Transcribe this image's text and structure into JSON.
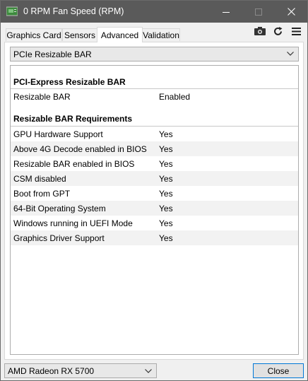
{
  "window": {
    "title": "0 RPM Fan Speed (RPM)"
  },
  "tabs": [
    {
      "label": "Graphics Card"
    },
    {
      "label": "Sensors"
    },
    {
      "label": "Advanced",
      "active": true
    },
    {
      "label": "Validation"
    }
  ],
  "toolbar": {
    "icons": [
      "camera-icon",
      "refresh-icon",
      "menu-icon"
    ]
  },
  "category_select": {
    "selected": "PCIe Resizable BAR"
  },
  "sections": {
    "pcie": {
      "heading": "PCI-Express Resizable BAR",
      "rows": [
        {
          "label": "Resizable BAR",
          "value": "Enabled"
        }
      ]
    },
    "requirements": {
      "heading": "Resizable BAR Requirements",
      "rows": [
        {
          "label": "GPU Hardware Support",
          "value": "Yes"
        },
        {
          "label": "Above 4G Decode enabled in BIOS",
          "value": "Yes"
        },
        {
          "label": "Resizable BAR enabled in BIOS",
          "value": "Yes"
        },
        {
          "label": "CSM disabled",
          "value": "Yes"
        },
        {
          "label": "Boot from GPT",
          "value": "Yes"
        },
        {
          "label": "64-Bit Operating System",
          "value": "Yes"
        },
        {
          "label": "Windows running in UEFI Mode",
          "value": "Yes"
        },
        {
          "label": "Graphics Driver Support",
          "value": "Yes"
        }
      ]
    }
  },
  "footer": {
    "gpu_select": "AMD Radeon RX 5700",
    "close_label": "Close"
  }
}
